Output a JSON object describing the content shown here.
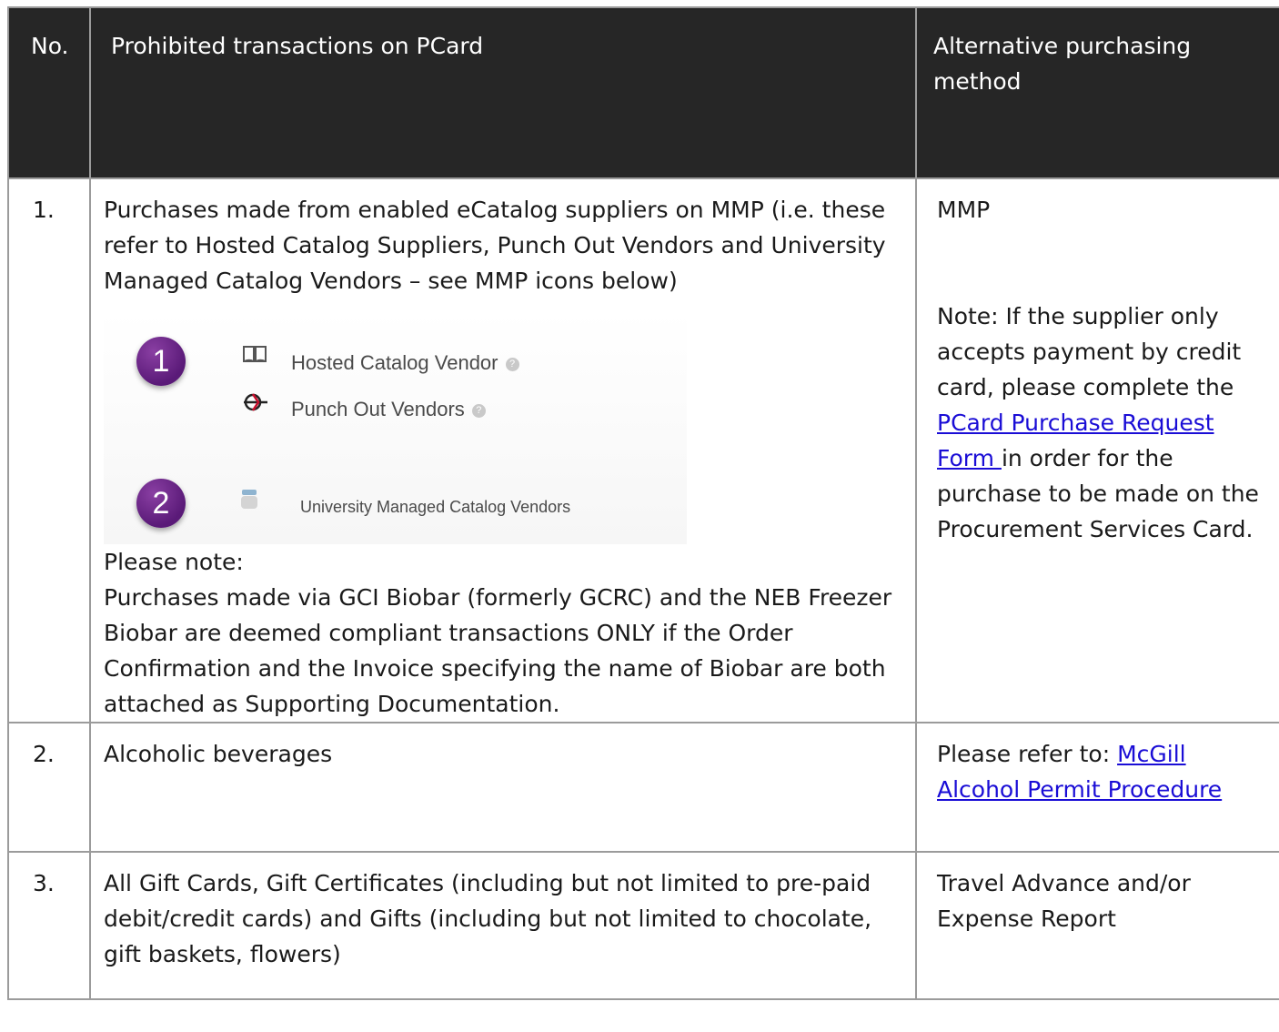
{
  "header": {
    "no": "No.",
    "prohibited": "Prohibited transactions on PCard",
    "alternative": "Alternative purchasing method"
  },
  "rows": [
    {
      "no": "1.",
      "text": "Purchases made from enabled eCatalog suppliers on MMP (i.e. these refer to Hosted Catalog Suppliers, Punch Out Vendors and University Managed Catalog Vendors – see MMP icons below)",
      "icons": {
        "badge1": "1",
        "hosted": "Hosted Catalog Vendor",
        "punch": "Punch Out Vendors",
        "badge2": "2",
        "university": "University Managed Catalog Vendors",
        "help_mark": "?"
      },
      "note_label": "Please note:",
      "note_text": "Purchases made via GCI Biobar (formerly GCRC) and the NEB Freezer Biobar are deemed compliant transactions ONLY if the Order Confirmation and the Invoice specifying the name of Biobar are both attached as Supporting Documentation.",
      "alt_title": "MMP",
      "alt_note_before": "Note: If the supplier only accepts payment by credit card, please complete the",
      "alt_link": " PCard Purchase Request Form ",
      "alt_note_after": "in order for the purchase to be made on the Procurement Services Card."
    },
    {
      "no": "2.",
      "text": "Alcoholic beverages",
      "alt_before": "Please refer to: ",
      "alt_link": "McGill Alcohol Permit Procedure"
    },
    {
      "no": "3.",
      "text": "All Gift Cards, Gift Certificates (including but not limited to pre-paid debit/credit cards) and Gifts (including but not limited to chocolate, gift baskets, flowers)",
      "alt": "Travel Advance and/or Expense Report"
    }
  ],
  "colors": {
    "header_bg": "#262626",
    "link": "#1a0dd6",
    "badge": "#5a1a78"
  }
}
